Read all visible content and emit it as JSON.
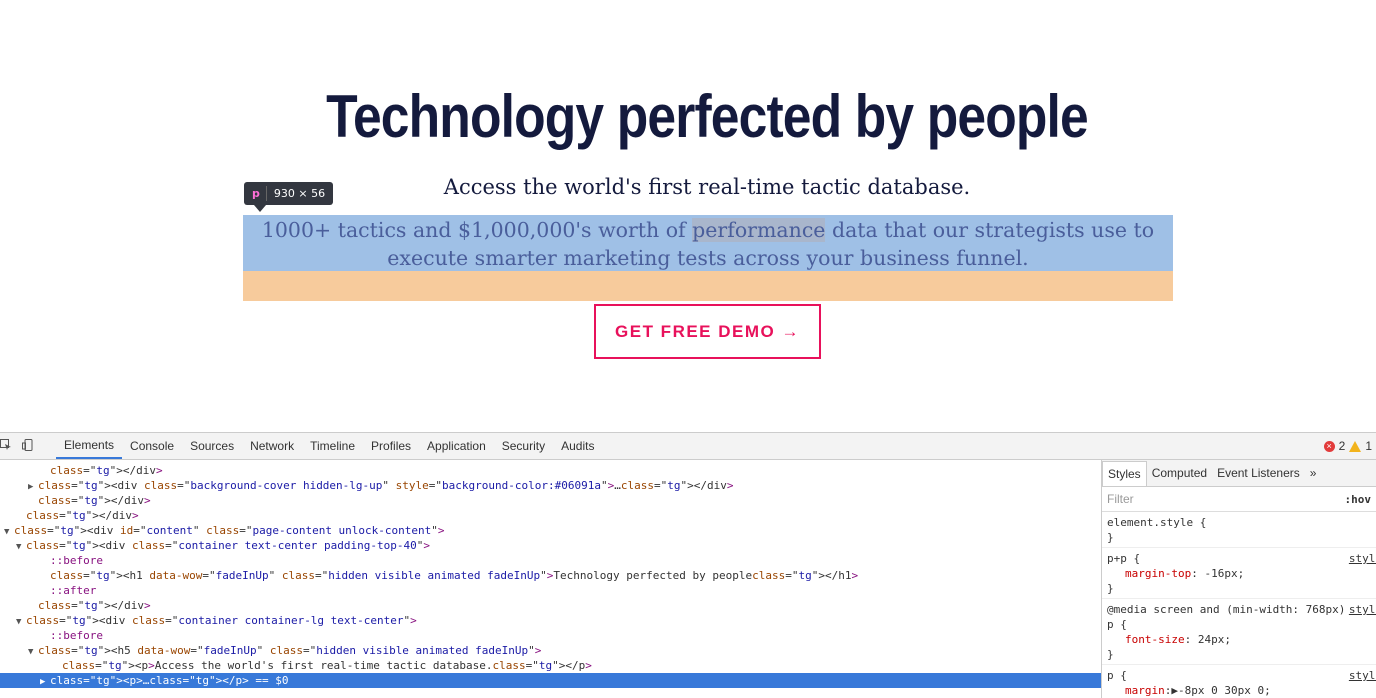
{
  "page": {
    "title": "Technology perfected by people",
    "subtitle": "Access the world's first real-time tactic database.",
    "paragraph_before": "1000+ tactics and $1,000,000's worth of ",
    "paragraph_highlight": "performance",
    "paragraph_after": " data that our strategists use to execute smarter marketing tests across your business funnel.",
    "cta_label": "GET FREE DEMO →"
  },
  "inspector_tooltip": {
    "tag": "p",
    "size": "930 × 56"
  },
  "devtools": {
    "tabs": [
      "Elements",
      "Console",
      "Sources",
      "Network",
      "Timeline",
      "Profiles",
      "Application",
      "Security",
      "Audits"
    ],
    "active_tab": "Elements",
    "errors": "2",
    "warnings": "1",
    "dom_lines": [
      "</div>",
      "<div class=\"background-cover hidden-lg-up\" style=\"background-color:#06091a\">…</div>",
      "</div>",
      "</div>",
      "<div id=\"content\" class=\"page-content unlock-content\">",
      "<div class=\"container text-center padding-top-40\">",
      "::before",
      "<h1 data-wow=\"fadeInUp\" class=\"hidden visible animated fadeInUp\">Technology perfected by people</h1>",
      "::after",
      "</div>",
      "<div class=\"container container-lg text-center\">",
      "::before",
      "<h5 data-wow=\"fadeInUp\" class=\"hidden visible animated fadeInUp\">",
      "<p>Access the world's first real-time tactic database.</p>",
      "<p>…</p> == $0"
    ],
    "styles_panel": {
      "tabs": [
        "Styles",
        "Computed",
        "Event Listeners"
      ],
      "filter_placeholder": "Filter",
      "hov_label": ":hov",
      "rules": [
        {
          "selector": "element.style {",
          "props": [],
          "close": "}",
          "source": ""
        },
        {
          "selector": "p+p {",
          "props": [
            {
              "name": "margin-top",
              "value": " -16px;"
            }
          ],
          "close": "}",
          "source": "style"
        },
        {
          "selector": "@media screen and (min-width: 768px)",
          "selector2": "p {",
          "props": [
            {
              "name": "font-size",
              "value": " 24px;"
            }
          ],
          "close": "}",
          "source": "style"
        },
        {
          "selector": "p {",
          "props": [
            {
              "name": "margin",
              "value": ":▶-8px 0 30px 0;"
            }
          ],
          "close": "",
          "source": "style"
        }
      ]
    }
  }
}
